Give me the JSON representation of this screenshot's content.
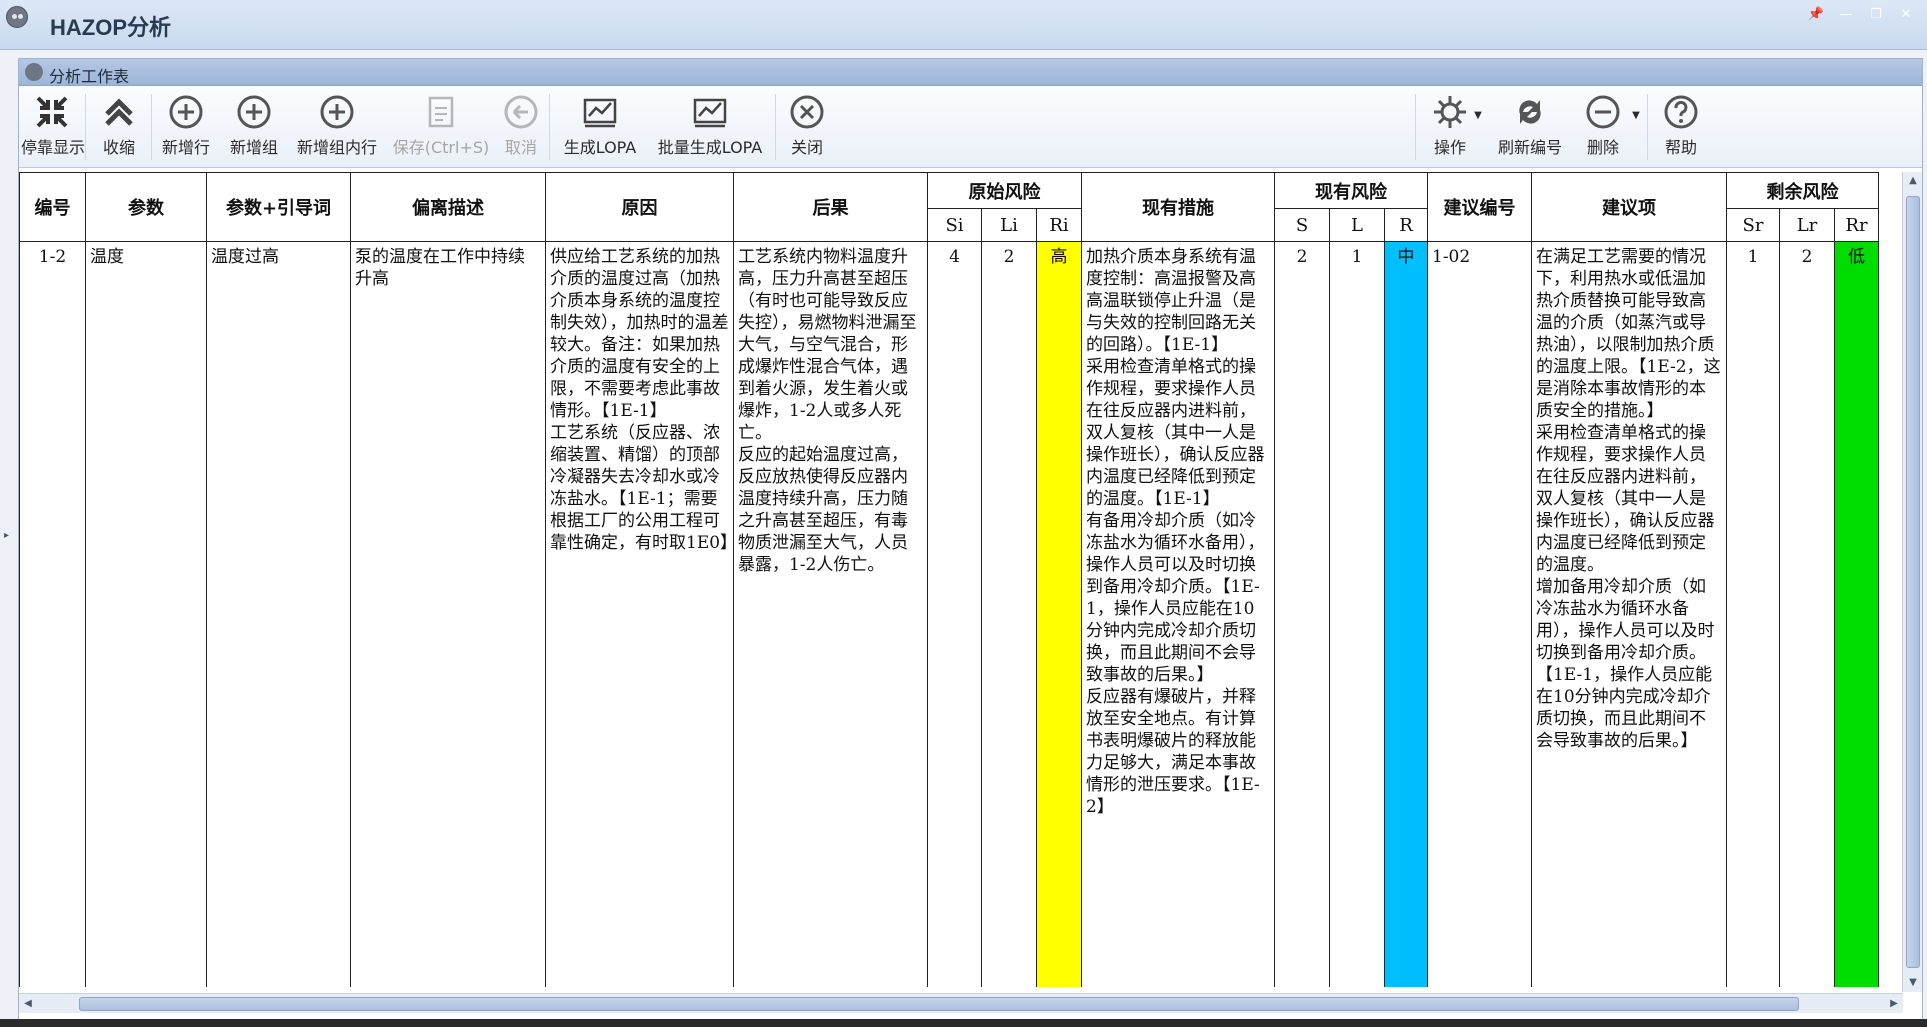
{
  "window": {
    "title": "HAZOP分析",
    "pin": "📌",
    "minimize": "—",
    "restore": "❐",
    "close": "✕"
  },
  "panel": {
    "title": "分析工作表"
  },
  "toolbar": {
    "dock": "停靠显示",
    "collapse": "收缩",
    "add_row": "新增行",
    "add_group": "新增组",
    "add_in_group": "新增组内行",
    "save": "保存(Ctrl+S)",
    "cancel": "取消",
    "gen_lopa": "生成LOPA",
    "batch_lopa": "批量生成LOPA",
    "close": "关闭",
    "operate": "操作",
    "refresh_no": "刷新编号",
    "delete": "删除",
    "help": "帮助"
  },
  "columns": {
    "no": "编号",
    "param": "参数",
    "param_guide": "参数+引导词",
    "deviation": "偏离描述",
    "cause": "原因",
    "consequence": "后果",
    "orig_risk": "原始风险",
    "si": "Si",
    "li": "Li",
    "ri": "Ri",
    "measures": "现有措施",
    "curr_risk": "现有风险",
    "s": "S",
    "l": "L",
    "r": "R",
    "rec_no": "建议编号",
    "rec": "建议项",
    "resid_risk": "剩余风险",
    "sr": "Sr",
    "lr": "Lr",
    "rr": "Rr"
  },
  "row": {
    "no": "1-2",
    "param": "温度",
    "param_guide": "温度过高",
    "deviation": "泵的温度在工作中持续升高",
    "cause": [
      "供应给工艺系统的加热介质的温度过高（加热介质本身系统的温度控制失效），加热时的温差较大。备注：如果加热介质的温度有安全的上限，不需要考虑此事故情形。【1E-1】",
      "工艺系统（反应器、浓缩装置、精馏）的顶部冷凝器失去冷却水或冷冻盐水。【1E-1；需要根据工厂的公用工程可靠性确定，有时取1E0】"
    ],
    "consequence": [
      "工艺系统内物料温度升高，压力升高甚至超压（有时也可能导致反应失控），易燃物料泄漏至大气，与空气混合，形成爆炸性混合气体，遇到着火源，发生着火或爆炸，1-2人或多人死亡。",
      "反应的起始温度过高，反应放热使得反应器内温度持续升高，压力随之升高甚至超压，有毒物质泄漏至大气，人员暴露，1-2人伤亡。"
    ],
    "si": "4",
    "li": "2",
    "ri": "高",
    "measures": [
      "加热介质本身系统有温度控制：高温报警及高高温联锁停止升温（是与失效的控制回路无关的回路）。【1E-1】",
      "采用检查清单格式的操作规程，要求操作人员在往反应器内进料前，双人复核（其中一人是操作班长），确认反应器内温度已经降低到预定的温度。【1E-1】",
      "有备用冷却介质（如冷冻盐水为循环水备用），操作人员可以及时切换到备用冷却介质。【1E-1，操作人员应能在10分钟内完成冷却介质切换，而且此期间不会导致事故的后果。】",
      "反应器有爆破片，并释放至安全地点。有计算书表明爆破片的释放能力足够大，满足本事故情形的泄压要求。【1E-2】"
    ],
    "s": "2",
    "l": "1",
    "r": "中",
    "rec_no": "1-02",
    "rec": [
      "在满足工艺需要的情况下，利用热水或低温加热介质替换可能导致高温的介质（如蒸汽或导热油），以限制加热介质的温度上限。【1E-2，这是消除本事故情形的本质安全的措施。】",
      "采用检查清单格式的操作规程，要求操作人员在往反应器内进料前，双人复核（其中一人是操作班长），确认反应器内温度已经降低到预定的温度。",
      "增加备用冷却介质（如冷冻盐水为循环水备用），操作人员可以及时切换到备用冷却介质。【1E-1，操作人员应能在10分钟内完成冷却介质切换，而且此期间不会导致事故的后果。】"
    ],
    "sr": "1",
    "lr": "2",
    "rr": "低"
  },
  "colors": {
    "high": "#ffff00",
    "medium": "#00bfff",
    "low": "#00dd00"
  }
}
